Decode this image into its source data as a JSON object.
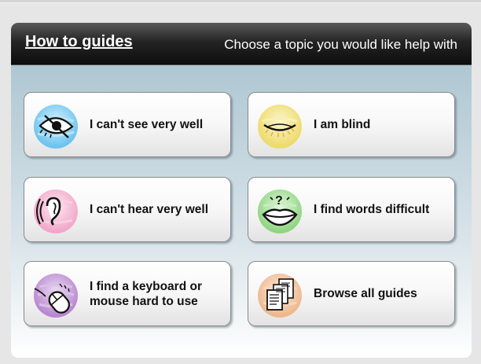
{
  "header": {
    "title": "How to guides",
    "subtitle": "Choose a topic you would like help with"
  },
  "topics": [
    {
      "label": "I can't see very well",
      "icon": "eye-icon",
      "color": "#8fd4f5"
    },
    {
      "label": "I am blind",
      "icon": "closed-eye-icon",
      "color": "#f1e58a"
    },
    {
      "label": "I can't hear very well",
      "icon": "ear-icon",
      "color": "#f5bcd6"
    },
    {
      "label": "I find words difficult",
      "icon": "mouth-question-icon",
      "color": "#a7e09c"
    },
    {
      "label": "I find a keyboard or mouse hard to use",
      "icon": "mouse-icon",
      "color": "#c69ad8"
    },
    {
      "label": "Browse all guides",
      "icon": "documents-icon",
      "color": "#f2c8a6"
    }
  ]
}
